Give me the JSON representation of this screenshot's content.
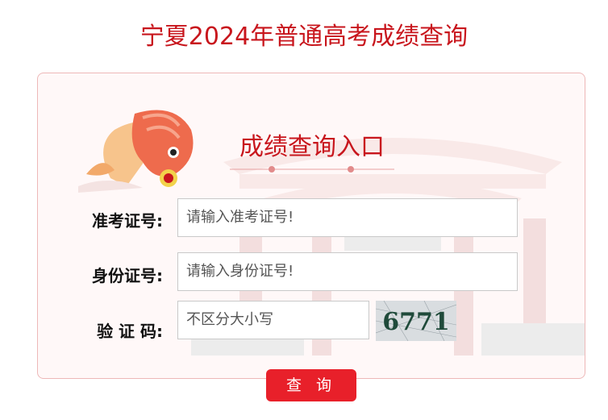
{
  "page": {
    "title": "宁夏2024年普通高考成绩查询"
  },
  "card": {
    "entry_title": "成绩查询入口"
  },
  "form": {
    "exam_id": {
      "label": "准考证号:",
      "placeholder": "请输入准考证号!"
    },
    "id_card": {
      "label": "身份证号:",
      "placeholder": "请输入身份证号!"
    },
    "captcha": {
      "label": "验 证 码:",
      "placeholder": "不区分大小写",
      "image_text": "6771"
    }
  },
  "actions": {
    "query_label": "查 询"
  },
  "colors": {
    "accent": "#c8161d",
    "button": "#e8202a",
    "card_border": "#eeb8b8"
  }
}
